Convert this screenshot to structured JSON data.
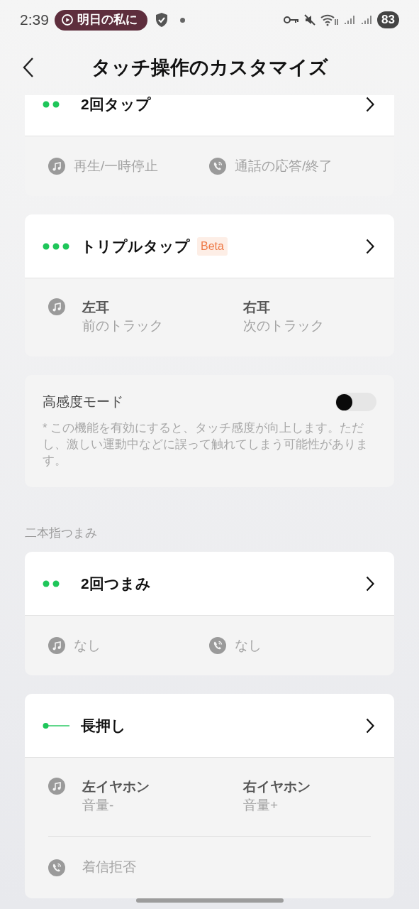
{
  "status_bar": {
    "time": "2:39",
    "media_pill": "明日の私に",
    "battery": "83"
  },
  "header": {
    "title": "タッチ操作のカスタマイズ"
  },
  "content": [
    {
      "kind": "double",
      "title": "2回タップ",
      "rows": [
        {
          "kind": "pair",
          "items": [
            {
              "kind": "music",
              "text": "再生/一時停止"
            },
            {
              "kind": "phone",
              "text": "通話の応答/終了"
            }
          ]
        }
      ]
    },
    {
      "kind": "triple",
      "title": "トリプルタップ",
      "badge": "Beta",
      "rows": [
        {
          "kind": "sides",
          "items": [
            {
              "label": "左耳",
              "value": "前のトラック"
            },
            {
              "label": "右耳",
              "value": "次のトラック"
            }
          ]
        }
      ]
    },
    {
      "kind": "toggle",
      "label": "高感度モード",
      "on": false,
      "note": "* この機能を有効にすると、タッチ感度が向上します。ただし、激しい運動中などに誤って触れてしまう可能性があります。"
    },
    {
      "kind": "section_label",
      "text": "二本指つまみ"
    },
    {
      "kind": "double",
      "title": "2回つまみ",
      "rows": [
        {
          "kind": "pair",
          "items": [
            {
              "kind": "music",
              "text": "なし"
            },
            {
              "kind": "phone",
              "text": "なし"
            }
          ]
        }
      ]
    },
    {
      "kind": "long",
      "title": "長押し",
      "rows": [
        {
          "kind": "sides",
          "items": [
            {
              "label": "左イヤホン",
              "value": "音量-"
            },
            {
              "label": "右イヤホン",
              "value": "音量+"
            }
          ]
        },
        {
          "kind": "single",
          "text": "着信拒否"
        }
      ]
    }
  ]
}
